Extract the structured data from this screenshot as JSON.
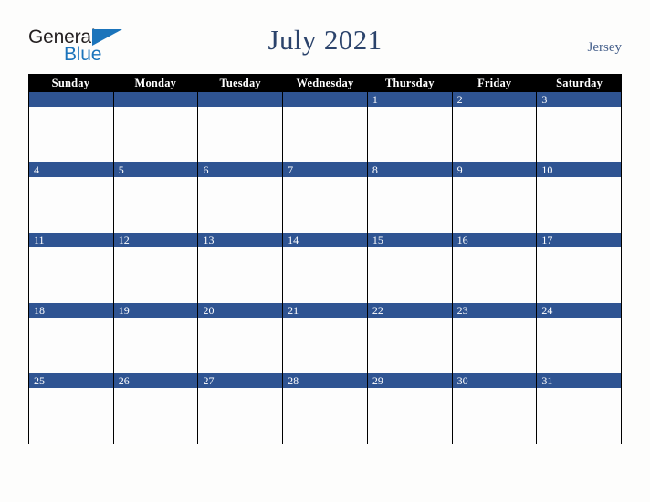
{
  "brand": {
    "line1": "General",
    "line2": "Blue",
    "triangle_icon": "blue-triangle-icon",
    "line1_color": "#231f20",
    "line2_color": "#1b74bb"
  },
  "header": {
    "title": "July 2021",
    "region": "Jersey",
    "title_color": "#2b436b",
    "region_color": "#47618c"
  },
  "calendar": {
    "weekday_headers": [
      "Sunday",
      "Monday",
      "Tuesday",
      "Wednesday",
      "Thursday",
      "Friday",
      "Saturday"
    ],
    "header_bg": "#000000",
    "header_text_color": "#ffffff",
    "day_bar_color": "#2f5492",
    "day_number_color": "#ffffff",
    "cell_bg": "#fdfdfd",
    "grid_line_color": "#000000",
    "weeks": [
      [
        "",
        "",
        "",
        "",
        "1",
        "2",
        "3"
      ],
      [
        "4",
        "5",
        "6",
        "7",
        "8",
        "9",
        "10"
      ],
      [
        "11",
        "12",
        "13",
        "14",
        "15",
        "16",
        "17"
      ],
      [
        "18",
        "19",
        "20",
        "21",
        "22",
        "23",
        "24"
      ],
      [
        "25",
        "26",
        "27",
        "28",
        "29",
        "30",
        "31"
      ]
    ]
  }
}
